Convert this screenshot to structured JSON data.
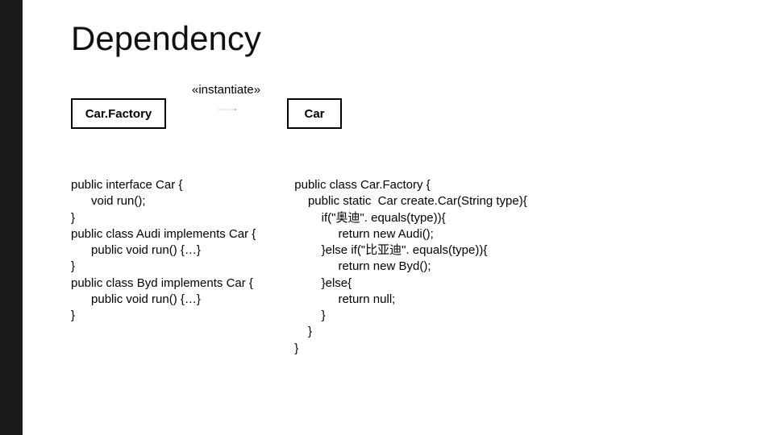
{
  "slide": {
    "title": "Dependency",
    "diagram": {
      "stereotype": "«instantiate»",
      "box_left": "Car.Factory",
      "box_right": "Car"
    },
    "code_left": "public interface Car {\n      void run();\n}\npublic class Audi implements Car {\n      public void run() {…}\n}\npublic class Byd implements Car {\n      public void run() {…}\n}",
    "code_right": "public class Car.Factory {\n    public static  Car create.Car(String type){\n        if(\"奥迪\". equals(type)){\n             return new Audi();\n        }else if(\"比亚迪\". equals(type)){\n             return new Byd();\n        }else{\n             return null;\n        }\n    }\n}"
  }
}
